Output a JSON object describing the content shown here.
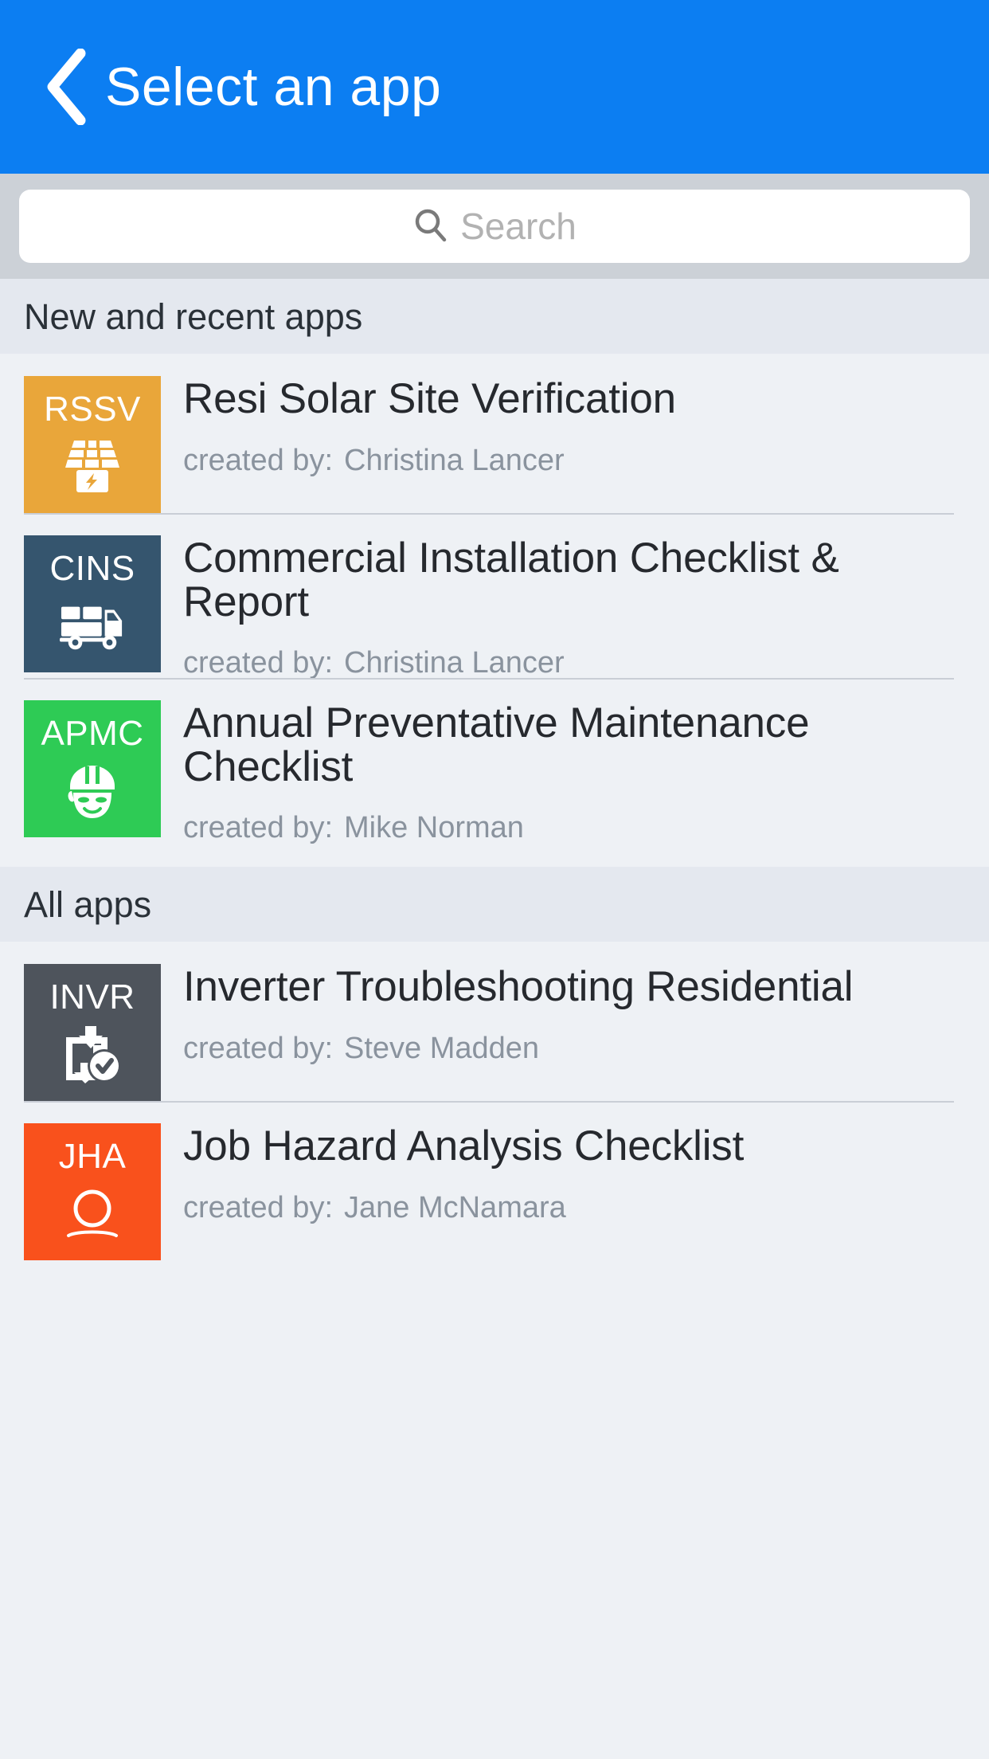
{
  "header": {
    "title": "Select an app",
    "back_icon": "chevron-left-icon",
    "background_color": "#0c7ef2"
  },
  "search": {
    "placeholder": "Search",
    "value": "",
    "icon": "search-icon"
  },
  "sections": [
    {
      "id": "new-and-recent",
      "label": "New and recent apps",
      "apps": [
        {
          "abbr": "RSSV",
          "title": "Resi Solar Site Verification",
          "created_by_label": "created by:",
          "author": "Christina Lancer",
          "color": "#e9a63a",
          "icon": "solar-panel-icon"
        },
        {
          "abbr": "CINS",
          "title": "Commercial Installation Checklist & Report",
          "created_by_label": "created by:",
          "author": "Christina Lancer",
          "color": "#35556e",
          "icon": "delivery-truck-icon"
        },
        {
          "abbr": "APMC",
          "title": "Annual Preventative Maintenance Checklist",
          "created_by_label": "created by:",
          "author": "Mike Norman",
          "color": "#2ecb55",
          "icon": "hard-hat-worker-icon"
        }
      ]
    },
    {
      "id": "all-apps",
      "label": "All apps",
      "apps": [
        {
          "abbr": "INVR",
          "title": "Inverter Troubleshooting Residential",
          "created_by_label": "created by:",
          "author": "Steve Madden",
          "color": "#4e545c",
          "icon": "inverter-check-icon"
        },
        {
          "abbr": "JHA",
          "title": "Job Hazard Analysis Checklist",
          "created_by_label": "created by:",
          "author": "Jane McNamara",
          "color": "#f9511c",
          "icon": "person-hazard-icon"
        }
      ]
    }
  ]
}
